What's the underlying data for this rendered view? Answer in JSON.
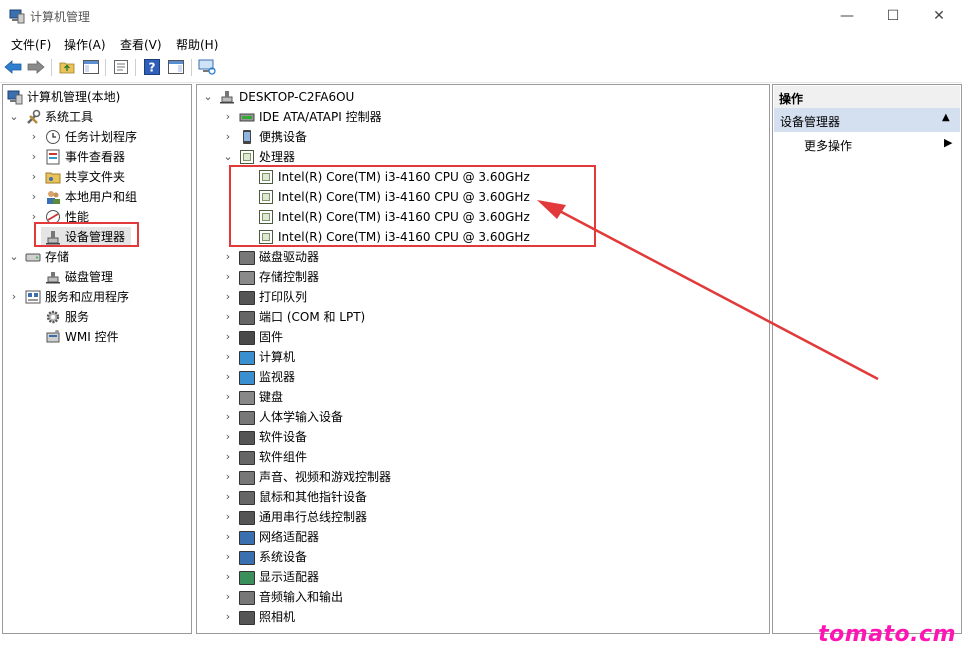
{
  "window": {
    "title": "计算机管理",
    "minimize": "—",
    "maximize": "☐",
    "close": "✕"
  },
  "menu": [
    "文件(F)",
    "操作(A)",
    "查看(V)",
    "帮助(H)"
  ],
  "left_tree": {
    "root": "计算机管理(本地)",
    "system_tools": "系统工具",
    "items": [
      "任务计划程序",
      "事件查看器",
      "共享文件夹",
      "本地用户和组",
      "性能",
      "设备管理器"
    ],
    "storage": "存储",
    "disk": "磁盘管理",
    "services_apps": "服务和应用程序",
    "services": "服务",
    "wmi": "WMI 控件"
  },
  "device_tree": {
    "root": "DESKTOP-C2FA6OU",
    "before": [
      "IDE ATA/ATAPI 控制器",
      "便携设备"
    ],
    "processor": "处理器",
    "cpus": [
      "Intel(R) Core(TM) i3-4160 CPU @ 3.60GHz",
      "Intel(R) Core(TM) i3-4160 CPU @ 3.60GHz",
      "Intel(R) Core(TM) i3-4160 CPU @ 3.60GHz",
      "Intel(R) Core(TM) i3-4160 CPU @ 3.60GHz"
    ],
    "after": [
      "磁盘驱动器",
      "存储控制器",
      "打印队列",
      "端口 (COM 和 LPT)",
      "固件",
      "计算机",
      "监视器",
      "键盘",
      "人体学输入设备",
      "软件设备",
      "软件组件",
      "声音、视频和游戏控制器",
      "鼠标和其他指针设备",
      "通用串行总线控制器",
      "网络适配器",
      "系统设备",
      "显示适配器",
      "音频输入和输出",
      "照相机"
    ]
  },
  "actions": {
    "header": "操作",
    "section": "设备管理器",
    "more": "更多操作"
  },
  "watermark": "tomato.cm",
  "colors": {
    "annotation_red": "#e23a3a",
    "watermark_pink": "#ff14b4",
    "selection_blue": "#d4dff0"
  }
}
